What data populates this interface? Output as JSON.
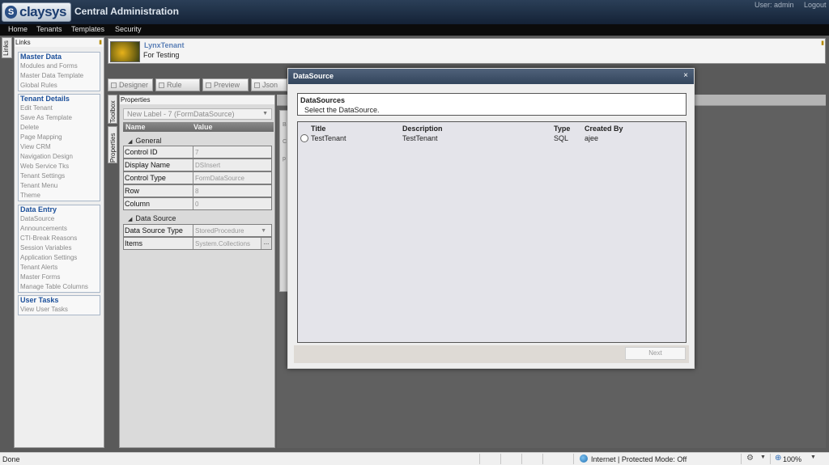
{
  "header": {
    "logo_mark": "S",
    "logo_text": "claysys",
    "app_title": "Central Administration",
    "user": "User: admin",
    "logout": "Logout"
  },
  "menu": [
    "Home",
    "Tenants",
    "Templates",
    "Security"
  ],
  "links_panel": {
    "tab_label": "Links",
    "title": "Links",
    "groups": [
      {
        "title": "Master Data",
        "items": [
          "Modules and Forms",
          "Master Data Template",
          "Global Rules"
        ]
      },
      {
        "title": "Tenant Details",
        "items": [
          "Edit Tenant",
          "Save As Template",
          "Delete",
          "Page Mapping",
          "View CRM",
          "Navigation Design",
          "Web Service Tks",
          "Tenant Settings",
          "Tenant Menu",
          "Theme"
        ]
      },
      {
        "title": "Data Entry",
        "items": [
          "DataSource",
          "Announcements",
          "CTI-Break Reasons",
          "Session Variables",
          "Application Settings",
          "Tenant Alerts",
          "Master Forms",
          "Manage Table Columns"
        ]
      },
      {
        "title": "User Tasks",
        "items": [
          "View User Tasks"
        ]
      }
    ]
  },
  "tenant": {
    "name": "LynxTenant",
    "description": "For Testing"
  },
  "toolbar": [
    "Designer",
    "Rule",
    "Preview",
    "Json"
  ],
  "side_tabs": [
    "Toolbox",
    "Properties"
  ],
  "properties": {
    "title": "Properties",
    "selected": "New Label - 7 (FormDataSource)",
    "col_name": "Name",
    "col_value": "Value",
    "general_title": "General",
    "general": [
      {
        "name": "Control ID",
        "value": "7"
      },
      {
        "name": "Display Name",
        "value": "DSInsert"
      },
      {
        "name": "Control Type",
        "value": "FormDataSource"
      },
      {
        "name": "Row",
        "value": "8"
      },
      {
        "name": "Column",
        "value": "0"
      }
    ],
    "datasource_title": "Data Source",
    "datasource": [
      {
        "name": "Data Source Type",
        "value": "StoredProcedure"
      },
      {
        "name": "Items",
        "value": "System.Collections"
      }
    ],
    "dots": "..."
  },
  "canvas_left_chars": [
    "B",
    "C",
    "p"
  ],
  "dialog": {
    "title": "DataSource",
    "close": "×",
    "section_title": "DataSources",
    "section_subtitle": "Select the  DataSource.",
    "columns": [
      "Title",
      "Description",
      "Type",
      "Created By"
    ],
    "rows": [
      {
        "title": "TestTenant",
        "description": "TestTenant",
        "type": "SQL",
        "created_by": "ajee"
      }
    ],
    "next_label": "Next"
  },
  "statusbar": {
    "status": "Done",
    "zone": "Internet | Protected Mode: Off",
    "zoom": "100%"
  }
}
